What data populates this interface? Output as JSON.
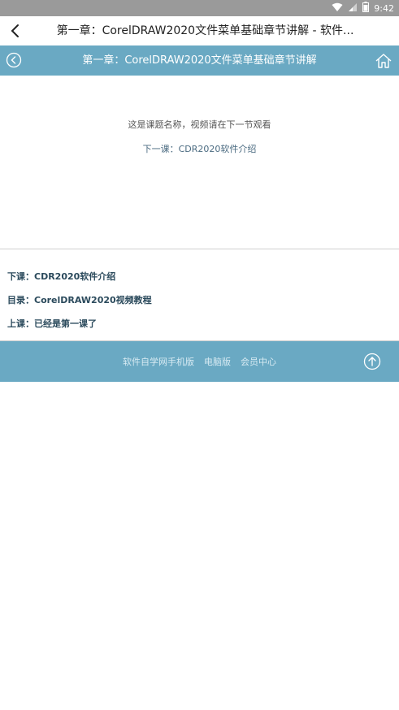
{
  "status": {
    "time": "9:42",
    "icons": [
      "wifi-icon",
      "signal-icon",
      "battery-icon"
    ]
  },
  "appbar": {
    "title": "第一章：CorelDRAW2020文件菜单基础章节讲解 - 软件..."
  },
  "pagehead": {
    "title": "第一章：CorelDRAW2020文件菜单基础章节讲解"
  },
  "content": {
    "line1": "这是课题名称，视频请在下一节观看",
    "line2": "下一课：CDR2020软件介绍"
  },
  "links": {
    "next": "下课：CDR2020软件介绍",
    "toc": "目录：CorelDRAW2020视频教程",
    "prev": "上课：已经是第一课了"
  },
  "footer": {
    "nav": [
      "软件自学网手机版",
      "电脑版",
      "会员中心"
    ]
  },
  "colors": {
    "accent": "#6aa9c3",
    "statusbar": "#9a9a9a"
  }
}
